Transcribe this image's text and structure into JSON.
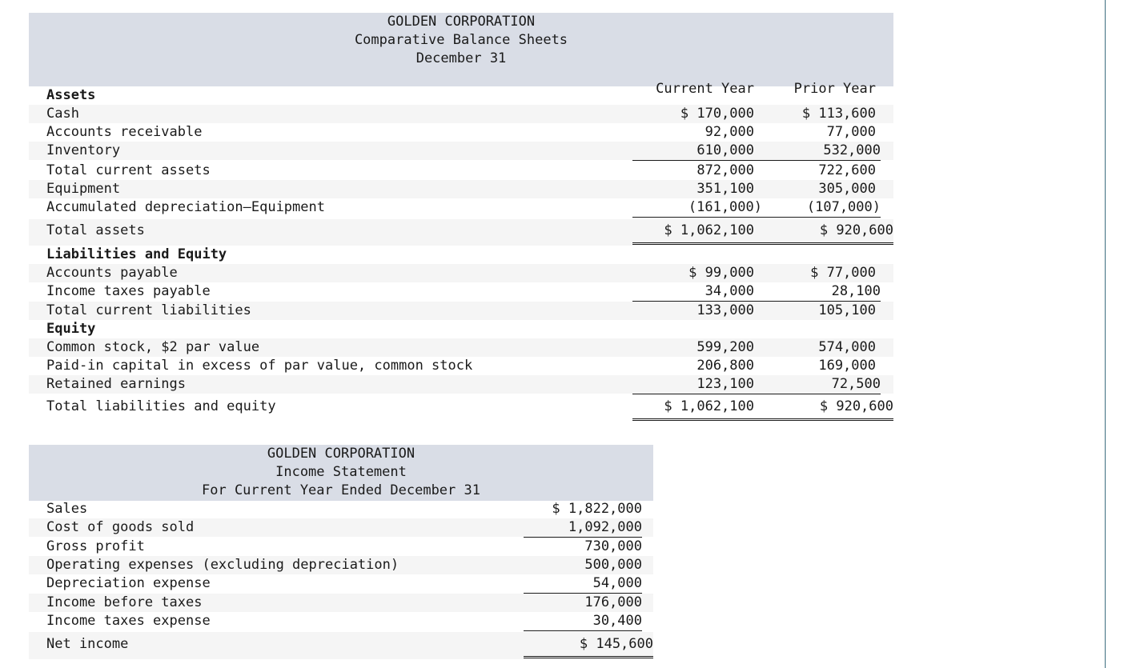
{
  "balance_sheet": {
    "company": "GOLDEN CORPORATION",
    "statement": "Comparative Balance Sheets",
    "date": "December 31",
    "col_current": "Current Year",
    "col_prior": "Prior Year",
    "rows": [
      {
        "label": "Assets",
        "cur": "",
        "pri": ""
      },
      {
        "label": "Cash",
        "cur": "$ 170,000",
        "pri": "$ 113,600"
      },
      {
        "label": "Accounts receivable",
        "cur": "92,000",
        "pri": "77,000"
      },
      {
        "label": "Inventory",
        "cur": "610,000",
        "pri": "532,000"
      },
      {
        "label": "Total current assets",
        "cur": "872,000",
        "pri": "722,600"
      },
      {
        "label": "Equipment",
        "cur": "351,100",
        "pri": "305,000"
      },
      {
        "label": "Accumulated depreciation—Equipment",
        "cur": "(161,000)",
        "pri": "(107,000)"
      },
      {
        "label": "Total assets",
        "cur": "$ 1,062,100",
        "pri": "$ 920,600"
      },
      {
        "label": "Liabilities and Equity",
        "cur": "",
        "pri": ""
      },
      {
        "label": "Accounts payable",
        "cur": "$ 99,000",
        "pri": "$ 77,000"
      },
      {
        "label": "Income taxes payable",
        "cur": "34,000",
        "pri": "28,100"
      },
      {
        "label": "Total current liabilities",
        "cur": "133,000",
        "pri": "105,100"
      },
      {
        "label": "Equity",
        "cur": "",
        "pri": ""
      },
      {
        "label": "Common stock, $2 par value",
        "cur": "599,200",
        "pri": "574,000"
      },
      {
        "label": "Paid-in capital in excess of par value, common stock",
        "cur": "206,800",
        "pri": "169,000"
      },
      {
        "label": "Retained earnings",
        "cur": "123,100",
        "pri": "72,500"
      },
      {
        "label": "Total liabilities and equity",
        "cur": "$ 1,062,100",
        "pri": "$ 920,600"
      }
    ]
  },
  "income_statement": {
    "company": "GOLDEN CORPORATION",
    "statement": "Income Statement",
    "period": "For Current Year Ended December 31",
    "rows": [
      {
        "label": "Sales",
        "val": "$ 1,822,000"
      },
      {
        "label": "Cost of goods sold",
        "val": "1,092,000"
      },
      {
        "label": "Gross profit",
        "val": "730,000"
      },
      {
        "label": "Operating expenses (excluding depreciation)",
        "val": "500,000"
      },
      {
        "label": "Depreciation expense",
        "val": "54,000"
      },
      {
        "label": "Income before taxes",
        "val": "176,000"
      },
      {
        "label": "Income taxes expense",
        "val": "30,400"
      },
      {
        "label": "Net income",
        "val": "$ 145,600"
      }
    ]
  }
}
